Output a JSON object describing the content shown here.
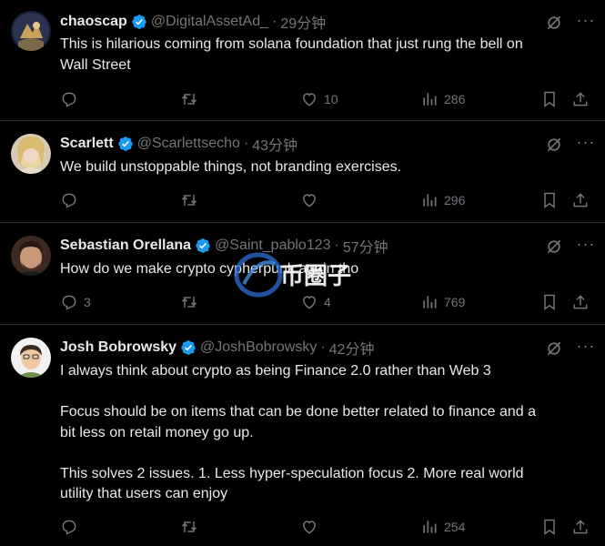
{
  "tweets": [
    {
      "name": "chaoscap",
      "handle": "@DigitalAssetAd_",
      "time": "29分钟",
      "text": "This is hilarious coming from solana foundation that just rung the bell on\nWall Street",
      "replies": "",
      "reposts": "",
      "likes": "10",
      "views": "286"
    },
    {
      "name": "Scarlett",
      "handle": "@Scarlettsecho",
      "time": "43分钟",
      "text": "We build unstoppable things, not branding exercises.",
      "replies": "",
      "reposts": "",
      "likes": "",
      "views": "296"
    },
    {
      "name": "Sebastian Orellana",
      "handle": "@Saint_pablo123",
      "time": "57分钟",
      "text": "How do we make crypto cypherpunk again tho",
      "replies": "3",
      "reposts": "",
      "likes": "4",
      "views": "769"
    },
    {
      "name": "Josh Bobrowsky",
      "handle": "@JoshBobrowsky",
      "time": "42分钟",
      "text": "I always think about crypto as being Finance 2.0 rather than Web 3\n\nFocus should be on items that can be done better related to finance and a\nbit less on retail money go up.\n\nThis solves 2 issues. 1. Less hyper-speculation focus 2. More real world\nutility that users can enjoy",
      "replies": "",
      "reposts": "",
      "likes": "",
      "views": "254"
    }
  ],
  "separator": "·",
  "watermark": "币圈子",
  "colors": {
    "background": "#000000",
    "text": "#e7e9ea",
    "secondary": "#71767b",
    "verified": "#1d9bf0",
    "border": "#2f3336"
  },
  "icons": [
    "verified-badge-icon",
    "grok-icon",
    "more-icon",
    "reply-icon",
    "repost-icon",
    "like-icon",
    "views-icon",
    "bookmark-icon",
    "share-icon"
  ]
}
